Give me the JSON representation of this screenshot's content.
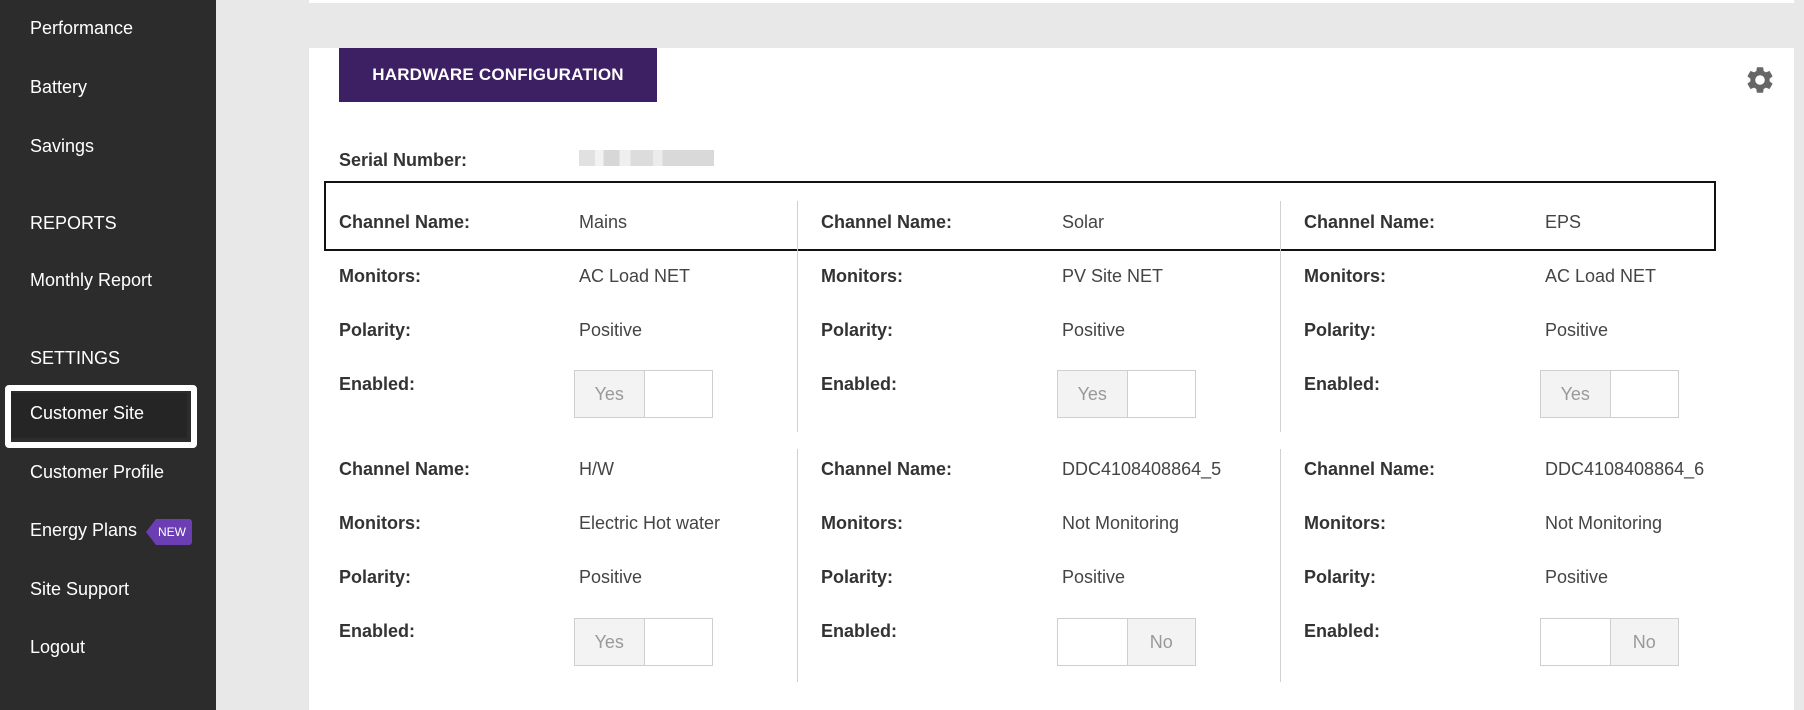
{
  "sidebar": {
    "items": [
      {
        "label": "Performance"
      },
      {
        "label": "Battery"
      },
      {
        "label": "Savings"
      },
      {
        "label": "REPORTS"
      },
      {
        "label": "Monthly Report"
      },
      {
        "label": "SETTINGS"
      },
      {
        "label": "Customer Site"
      },
      {
        "label": "Customer Profile"
      },
      {
        "label": "Energy Plans"
      },
      {
        "label": "Site Support"
      },
      {
        "label": "Logout"
      }
    ],
    "new_badge": "NEW",
    "active_item": "Customer Site"
  },
  "card": {
    "header": "HARDWARE CONFIGURATION",
    "serial_label": "Serial Number:",
    "labels": {
      "channel_name": "Channel Name:",
      "monitors": "Monitors:",
      "polarity": "Polarity:",
      "enabled": "Enabled:"
    },
    "toggle": {
      "yes": "Yes",
      "no": "No"
    },
    "channels": [
      {
        "name": "Mains",
        "monitors": "AC Load NET",
        "polarity": "Positive",
        "enabled": "Yes"
      },
      {
        "name": "Solar",
        "monitors": "PV Site NET",
        "polarity": "Positive",
        "enabled": "Yes"
      },
      {
        "name": "EPS",
        "monitors": "AC Load NET",
        "polarity": "Positive",
        "enabled": "Yes"
      },
      {
        "name": "H/W",
        "monitors": "Electric Hot water",
        "polarity": "Positive",
        "enabled": "Yes"
      },
      {
        "name": "DDC4108408864_5",
        "monitors": "Not Monitoring",
        "polarity": "Positive",
        "enabled": "No"
      },
      {
        "name": "DDC4108408864_6",
        "monitors": "Not Monitoring",
        "polarity": "Positive",
        "enabled": "No"
      }
    ]
  },
  "colors": {
    "sidebar_bg": "#2c2c2c",
    "header_bg": "#3d1f63",
    "badge_bg": "#6b3fb3"
  },
  "icons": [
    "gear-icon"
  ]
}
